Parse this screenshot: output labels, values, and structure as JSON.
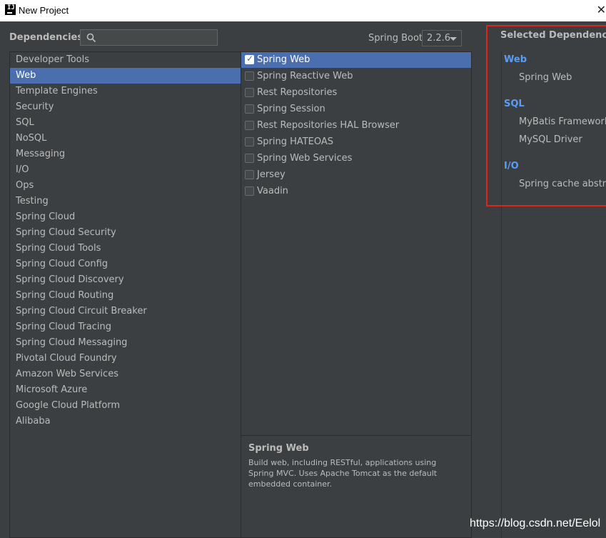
{
  "window": {
    "title": "New Project"
  },
  "header": {
    "dependencies_label": "Dependencies",
    "search": {
      "value": "",
      "placeholder": ""
    },
    "spring_boot_label": "Spring Boot",
    "spring_boot_version": "2.2.6"
  },
  "categories": [
    {
      "label": "Developer Tools"
    },
    {
      "label": "Web"
    },
    {
      "label": "Template Engines"
    },
    {
      "label": "Security"
    },
    {
      "label": "SQL"
    },
    {
      "label": "NoSQL"
    },
    {
      "label": "Messaging"
    },
    {
      "label": "I/O"
    },
    {
      "label": "Ops"
    },
    {
      "label": "Testing"
    },
    {
      "label": "Spring Cloud"
    },
    {
      "label": "Spring Cloud Security"
    },
    {
      "label": "Spring Cloud Tools"
    },
    {
      "label": "Spring Cloud Config"
    },
    {
      "label": "Spring Cloud Discovery"
    },
    {
      "label": "Spring Cloud Routing"
    },
    {
      "label": "Spring Cloud Circuit Breaker"
    },
    {
      "label": "Spring Cloud Tracing"
    },
    {
      "label": "Spring Cloud Messaging"
    },
    {
      "label": "Pivotal Cloud Foundry"
    },
    {
      "label": "Amazon Web Services"
    },
    {
      "label": "Microsoft Azure"
    },
    {
      "label": "Google Cloud Platform"
    },
    {
      "label": "Alibaba"
    }
  ],
  "selected_category": "Web",
  "dependencies": [
    {
      "label": "Spring Web",
      "checked": true
    },
    {
      "label": "Spring Reactive Web",
      "checked": false
    },
    {
      "label": "Rest Repositories",
      "checked": false
    },
    {
      "label": "Spring Session",
      "checked": false
    },
    {
      "label": "Rest Repositories HAL Browser",
      "checked": false
    },
    {
      "label": "Spring HATEOAS",
      "checked": false
    },
    {
      "label": "Spring Web Services",
      "checked": false
    },
    {
      "label": "Jersey",
      "checked": false
    },
    {
      "label": "Vaadin",
      "checked": false
    }
  ],
  "description": {
    "title": "Spring Web",
    "text": "Build web, including RESTful, applications using Spring MVC. Uses Apache Tomcat as the default embedded container."
  },
  "selected_dependencies": {
    "title": "Selected Dependencies",
    "groups": [
      {
        "name": "Web",
        "items": [
          "Spring Web"
        ]
      },
      {
        "name": "SQL",
        "items": [
          "MyBatis Framework",
          "MySQL Driver"
        ]
      },
      {
        "name": "I/O",
        "items": [
          "Spring cache abstrac"
        ]
      }
    ]
  },
  "watermark": "https://blog.csdn.net/Eelol",
  "colors": {
    "selection": "#4b6eaf",
    "group_heading": "#589df6",
    "highlight_box": "#e0241c",
    "background": "#3c3f41"
  }
}
